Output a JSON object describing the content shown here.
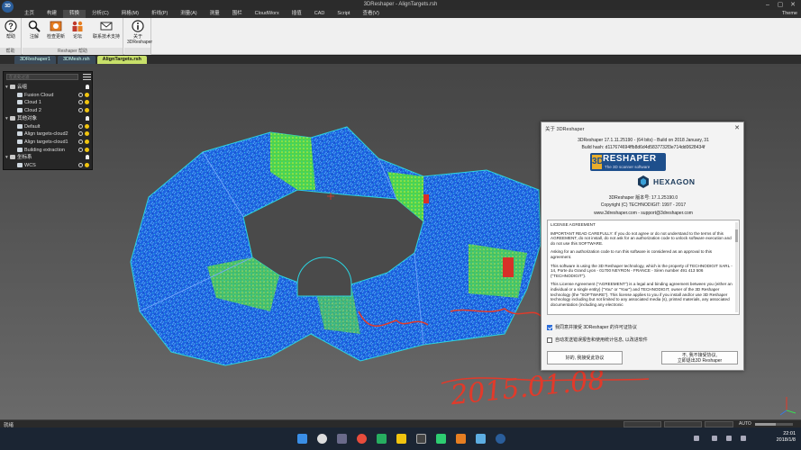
{
  "window": {
    "title": "3DReshaper - AlignTargets.rsh",
    "logo_text": "3D"
  },
  "menu": {
    "items": [
      "主页",
      "构建",
      "转换",
      "分析(C)",
      "网格(M)",
      "折线(P)",
      "测量(A)",
      "测量",
      "围栏",
      "CloudWorx",
      "插值",
      "CAD",
      "Script",
      "查看(V)"
    ],
    "theme_label": "Theme"
  },
  "ribbon": {
    "buttons": [
      {
        "label": "帮助",
        "icon": "help-icon"
      },
      {
        "label": "注解",
        "icon": "search-icon"
      },
      {
        "label": "检查更新",
        "icon": "update-icon"
      },
      {
        "label": "论坛",
        "icon": "forum-icon"
      },
      {
        "label": "联系技术支持",
        "icon": "mail-icon"
      },
      {
        "label": "关于\n3DReshaper",
        "icon": "info-icon"
      }
    ],
    "groups": [
      "帮助",
      "Reshaper 帮助",
      ""
    ]
  },
  "doc_tabs": [
    "3DReshaper1",
    "3DMesh.rsh",
    "AlignTargets.rsh"
  ],
  "active_doc_tab": 2,
  "tree": {
    "search_placeholder": "在此处过滤",
    "rows": [
      {
        "label": "云组",
        "category": true
      },
      {
        "label": "Fusion Cloud",
        "category": false
      },
      {
        "label": "Cloud 1",
        "category": false
      },
      {
        "label": "Cloud 2",
        "category": false
      },
      {
        "label": "其他对象",
        "category": true
      },
      {
        "label": "Default",
        "category": false
      },
      {
        "label": "Align targets-cloud2",
        "category": false
      },
      {
        "label": "Align targets-cloud1",
        "category": false
      },
      {
        "label": "Building extraction",
        "category": false
      },
      {
        "label": "坐标系",
        "category": true
      },
      {
        "label": "WCS",
        "category": false
      }
    ]
  },
  "dialog": {
    "title": "关于 3DReshaper",
    "close_glyph": "✕",
    "version_line": "3DReshaper 17.1.11.25190 - (64 bits) - Build on 2018 January, 31",
    "build_hash": "Build hash: d117674694ffb8d6d4d5837732f3e714dd0628434f",
    "logo_main": "RESHAPER",
    "logo_sub": "The 3D scanner software",
    "logo_emblem": "3D",
    "hexagon_text": "HEXAGON",
    "engine_line": "3DReshaper 版本号: 17.1.25190.0",
    "copyright": "Copyright (C) TECHNODIGIT: 1997 - 2017",
    "links": "www.3dreshaper.com      -      support@3dreshaper.com",
    "license_paragraphs": [
      "LICENSE AGREEMENT",
      "IMPORTANT READ CAREFULLY: If you do not agree or do not understand to the terms of this AGREEMENT, do not install, do not ask for an authorization code to unlock software execution and do not use this SOFTWARE.",
      "Asking for an authorization code to run this software is considered as an approval to this agreement.",
      "This software is using the 3D Reshaper technology, which is the property of TECHNODIGIT SARL - 14, Porte du Grand Lyon - 01700 NEYRON - FRANCE - Siren number 491 413 506 (\"TECHNODIGIT\").",
      "This License Agreement (\"AGREEMENT\") is a legal and binding agreement between you (either an individual or a single entity) (\"You\" or \"Your\") and TECHNODIGIT, owner of the 3D Reshaper technology (the \"SOFTWARE\"). This license applies to you if you install and/or use 3D Reshaper technology including but not limited to any associated media (s), printed materials, any associated documentation (including any electronic"
    ],
    "checkbox1": "我同意并接受 3DReshaper 的许可证协议",
    "checkbox1_checked": true,
    "checkbox2": "自动发送错误报告和使用统计信息, 以改进软件",
    "checkbox2_checked": false,
    "accept_btn": "好的, 我接受此协议",
    "decline_btn": "不, 我不接受协议,\n立即退出3D Reshaper"
  },
  "statusbar": {
    "text": "就绪",
    "auto_label": "AUTO",
    "zoom_fraction": 0.55
  },
  "taskbar": {
    "time": "22:01",
    "date": "2018/1/8"
  },
  "handwriting": "2015.01.08",
  "colors": {
    "ribbon_bg": "#f0f0f0",
    "active_tab": "#c8e06a",
    "cloud_blue": "#1f6ff0",
    "cloud_cyan": "#2fd9d9",
    "cloud_green": "#6ee83a",
    "cloud_red": "#e0342a",
    "ink_red": "#e23a2a"
  }
}
